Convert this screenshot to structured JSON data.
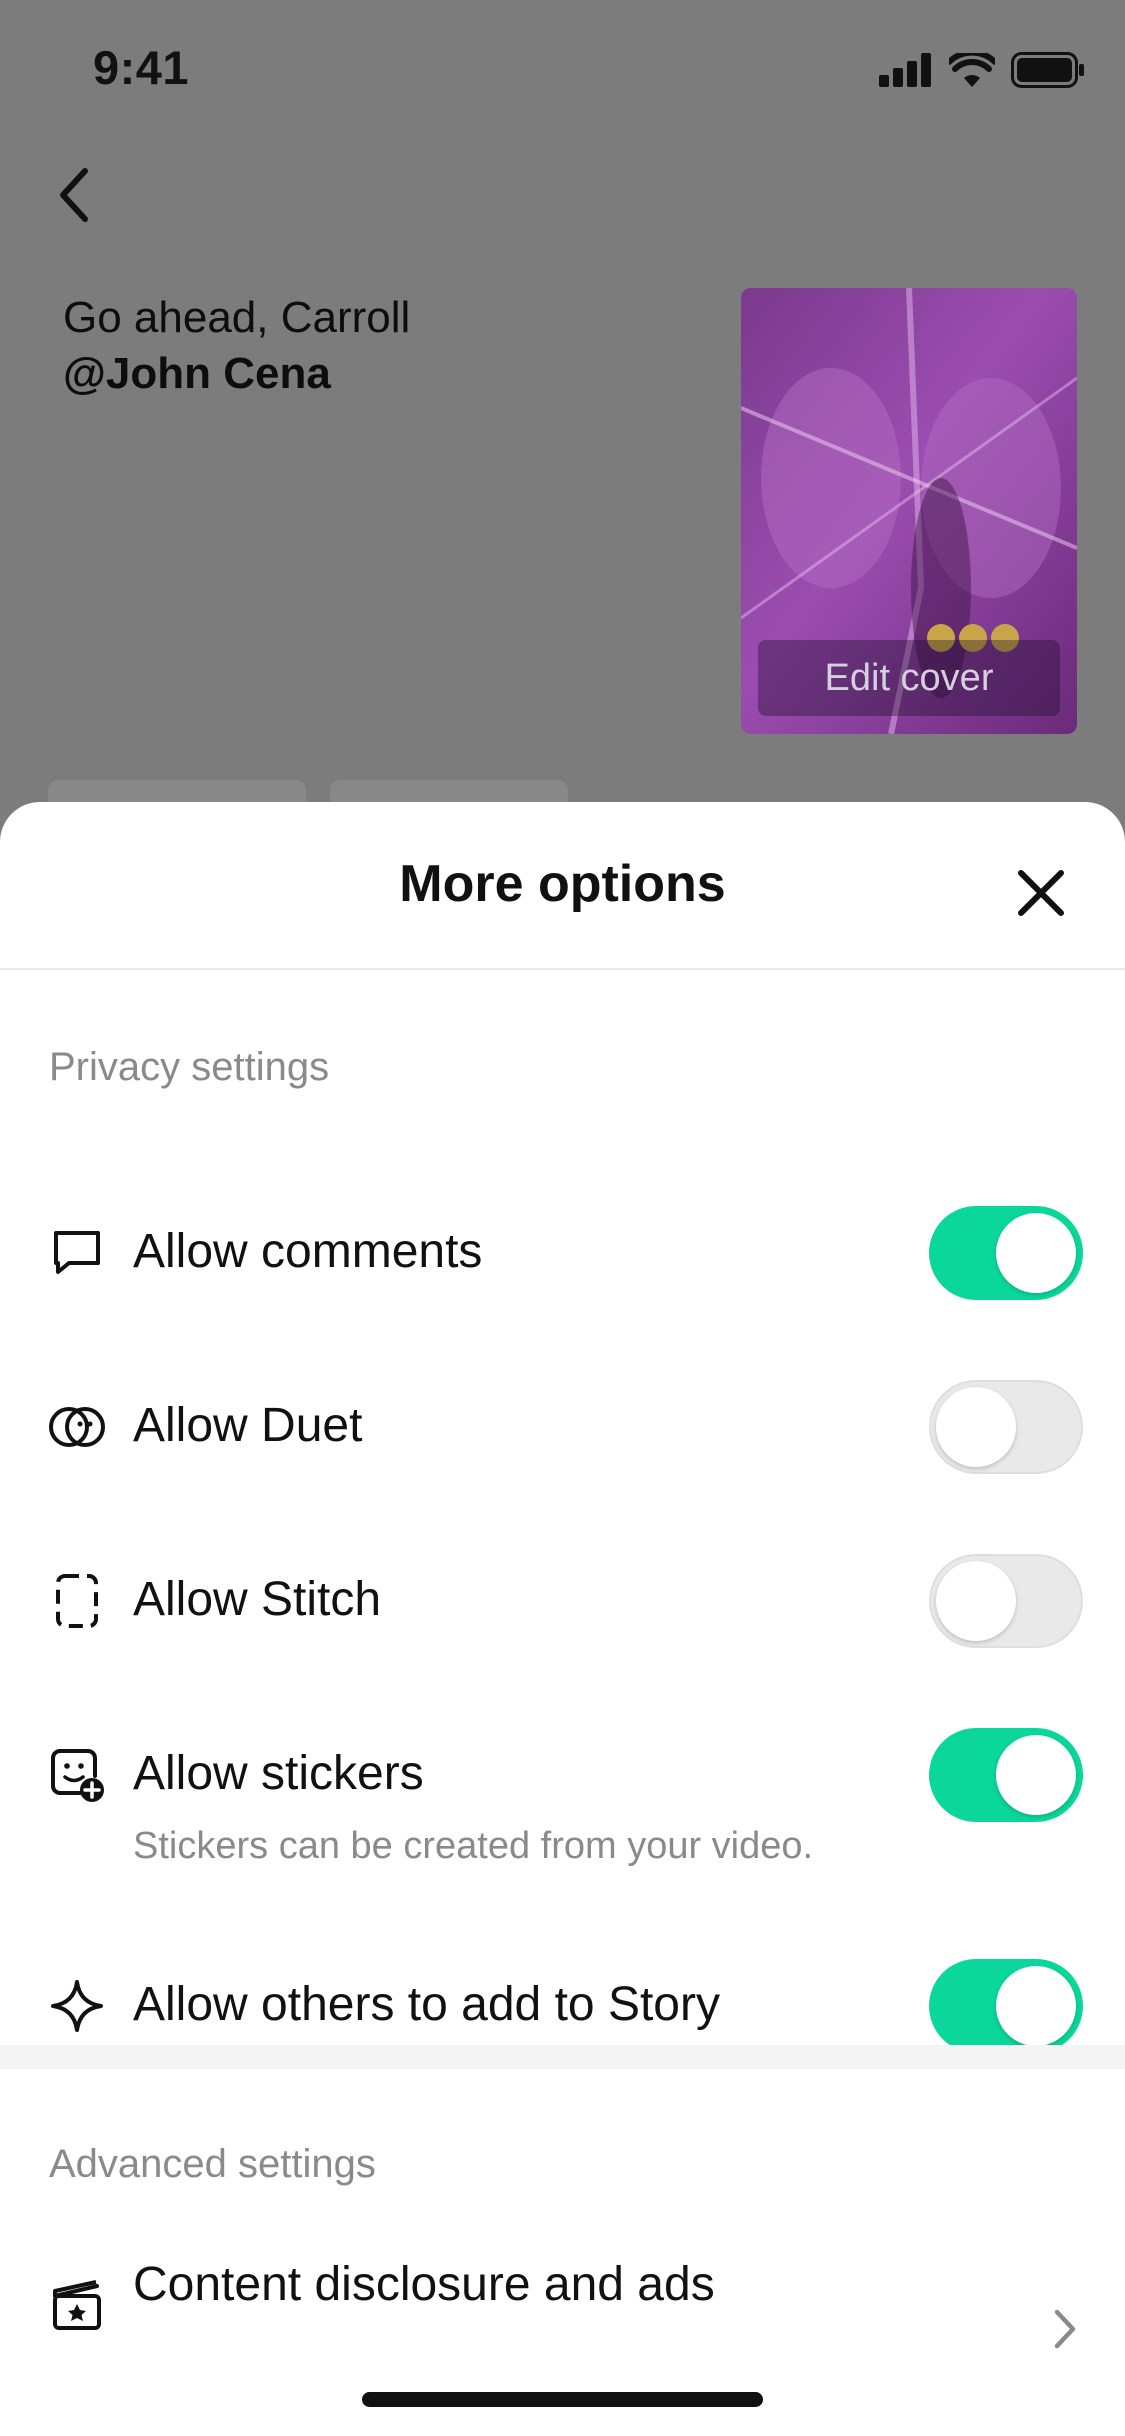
{
  "status_bar": {
    "time": "9:41"
  },
  "background": {
    "caption_text": "Go ahead, Carroll",
    "caption_mention": "@John Cena",
    "cover_button": "Edit cover"
  },
  "sheet": {
    "title": "More options",
    "privacy_section_label": "Privacy settings",
    "options": [
      {
        "label": "Allow comments",
        "icon": "comment-bubble-icon",
        "enabled": true
      },
      {
        "label": "Allow Duet",
        "icon": "duet-icon",
        "enabled": false
      },
      {
        "label": "Allow Stitch",
        "icon": "stitch-icon",
        "enabled": false
      },
      {
        "label": "Allow stickers",
        "icon": "sticker-add-icon",
        "enabled": true,
        "subtitle": "Stickers can be created from your video."
      },
      {
        "label": "Allow others to add to Story",
        "icon": "sparkle-icon",
        "enabled": true
      }
    ],
    "advanced_section_label": "Advanced settings",
    "advanced_items": [
      {
        "label": "Content disclosure and ads",
        "icon": "clapperboard-star-icon"
      }
    ]
  },
  "colors": {
    "toggle_on": "#0bd79a",
    "toggle_off": "#e9e9e9",
    "scrim": "#7c7c7c"
  }
}
